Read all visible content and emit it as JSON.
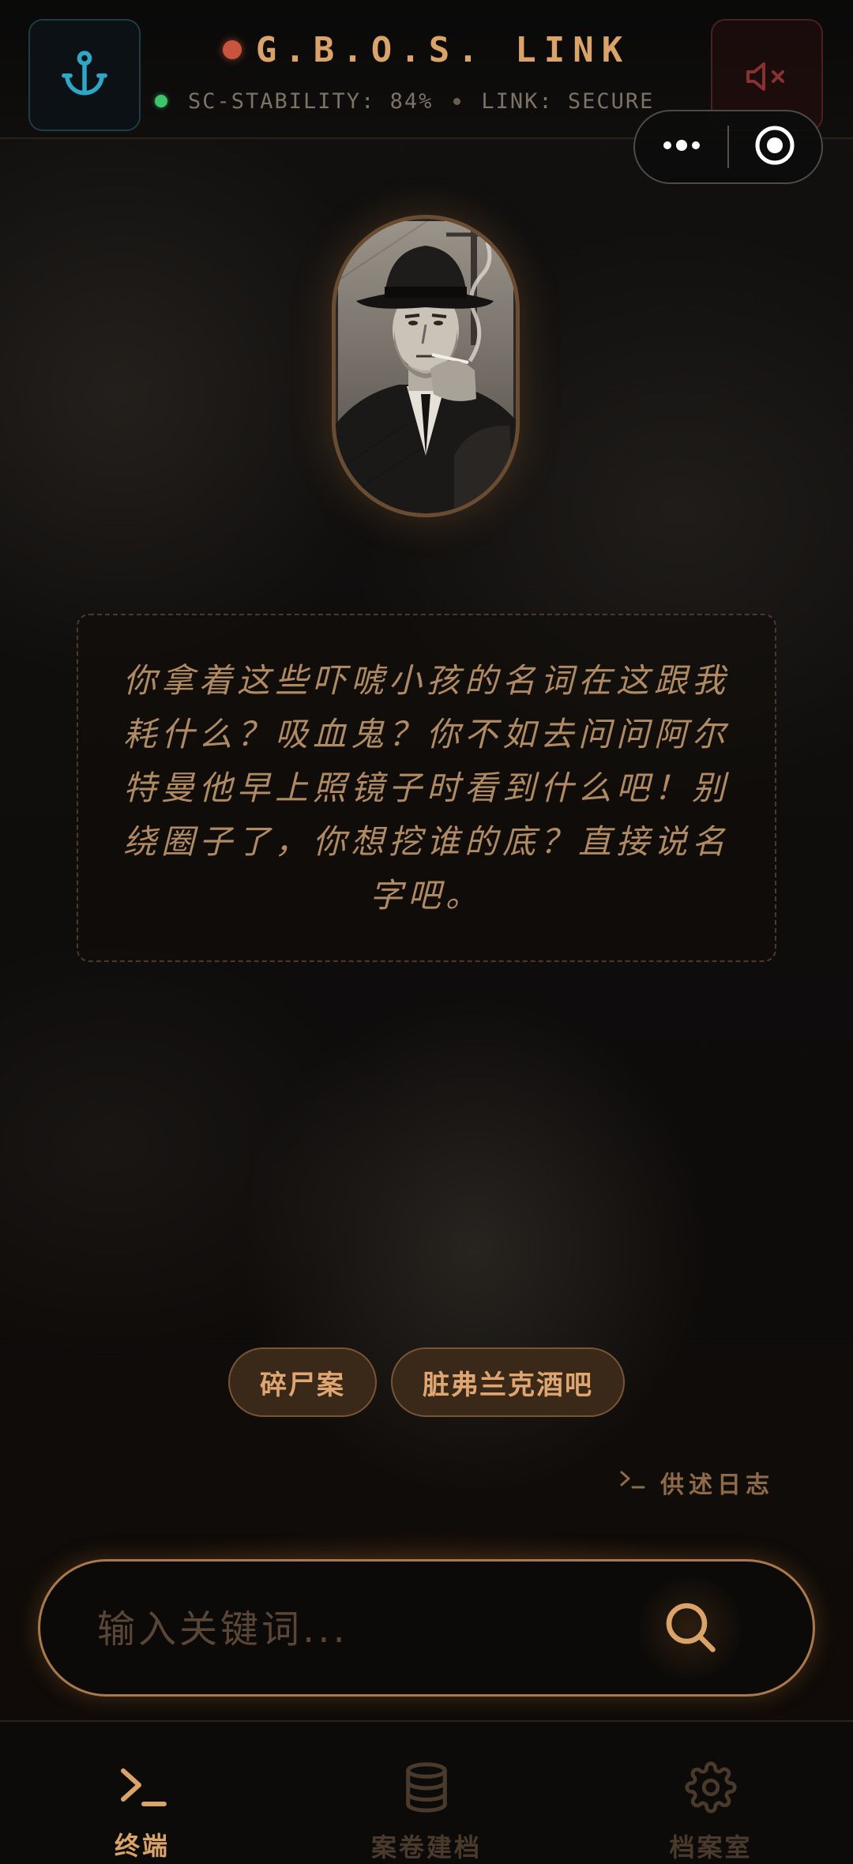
{
  "header": {
    "title": "G.B.O.S. LINK",
    "stability": "SC-STABILITY: 84%",
    "link_status": "LINK: SECURE",
    "left_icon": "anchor-icon",
    "right_icon": "speaker-muted-icon"
  },
  "miniprogram_capsule": {
    "menu_icon": "more-dots-icon",
    "close_icon": "target-circle-icon"
  },
  "portrait": {
    "subject": "detective-in-fedora-smoking"
  },
  "dialogue": {
    "text": "你拿着这些吓唬小孩的名词在这跟我耗什么？吸血鬼？你不如去问问阿尔特曼他早上照镜子时看到什么吧！别绕圈子了，你想挖谁的底？直接说名字吧。"
  },
  "chips": [
    "碎尸案",
    "脏弗兰克酒吧"
  ],
  "log_link": {
    "icon": "terminal-prompt-icon",
    "label": "供述日志"
  },
  "search": {
    "placeholder": "输入关键词...",
    "value": ""
  },
  "bottom_nav": [
    {
      "label": "终端",
      "icon": "terminal-icon",
      "active": true
    },
    {
      "label": "案卷建档",
      "icon": "database-icon",
      "active": false
    },
    {
      "label": "档案室",
      "icon": "gear-icon",
      "active": false
    }
  ],
  "colors": {
    "accent": "#d9a36a",
    "record_dot": "#c9553f",
    "online_dot": "#3ec46a",
    "anchor": "#2fa6c4",
    "muted_red": "#8a3030"
  }
}
